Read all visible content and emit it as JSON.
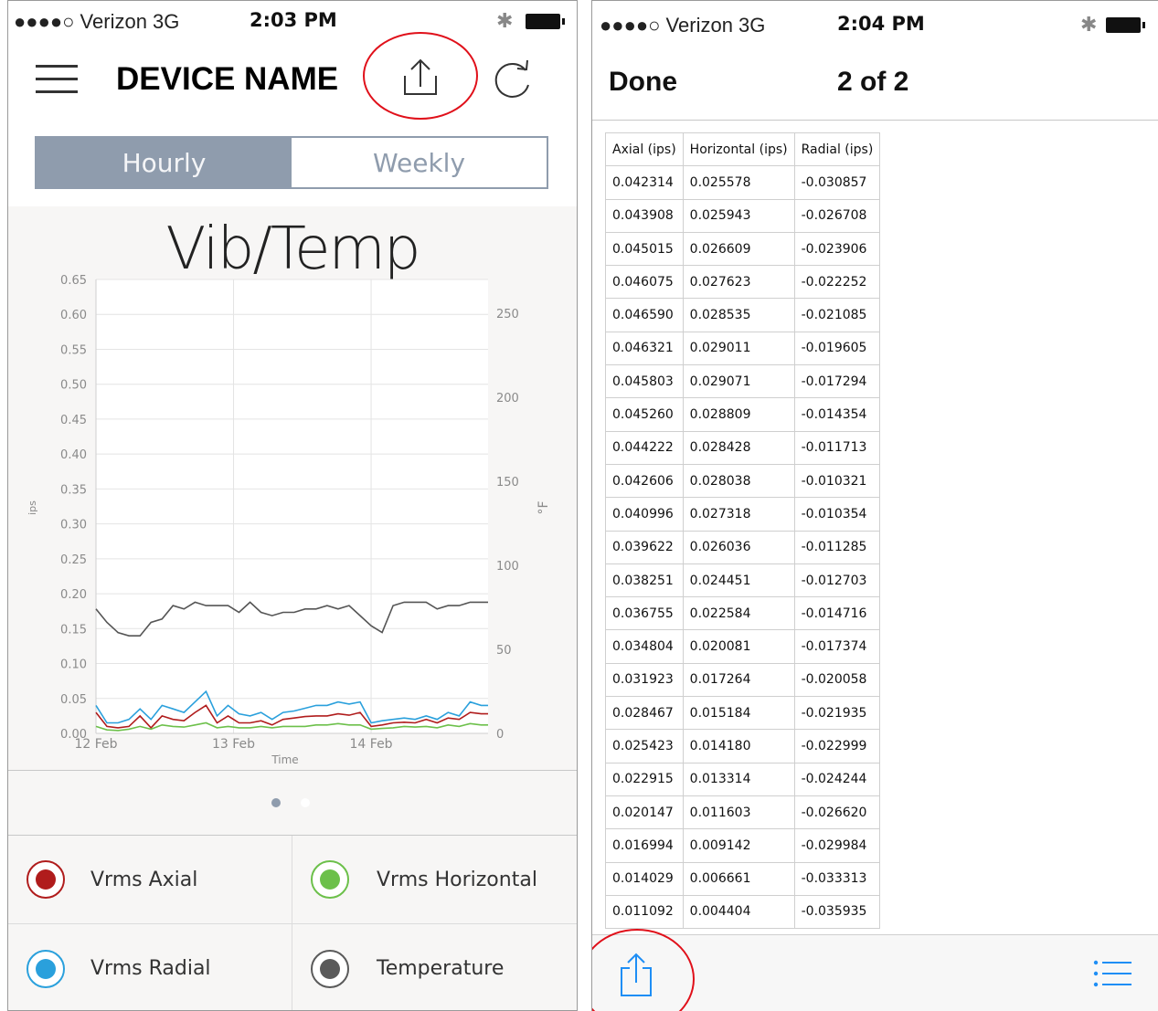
{
  "left": {
    "status": {
      "carrier": "●●●●○ Verizon  3G",
      "time": "2:03 PM",
      "bluetooth": "✱"
    },
    "header": {
      "title": "DEVICE NAME",
      "menu_icon": "hamburger-icon",
      "share_icon": "share-icon",
      "refresh_icon": "refresh-icon"
    },
    "segments": {
      "hourly": "Hourly",
      "weekly": "Weekly",
      "selected": "Hourly"
    },
    "chart_data": {
      "type": "line",
      "title": "Vib/Temp",
      "xlabel": "Time",
      "ylabel": "ips",
      "y2label": "°F",
      "x_ticks": [
        "12 Feb",
        "13 Feb",
        "14 Feb"
      ],
      "y_ticks": [
        "0.00",
        "0.05",
        "0.10",
        "0.15",
        "0.20",
        "0.25",
        "0.30",
        "0.35",
        "0.40",
        "0.45",
        "0.50",
        "0.55",
        "0.60",
        "0.65"
      ],
      "y2_ticks": [
        "0",
        "50",
        "100",
        "150",
        "200",
        "250"
      ],
      "ylim": [
        0,
        0.65
      ],
      "y2lim": [
        0,
        270
      ],
      "xlim": [
        0,
        2.85
      ],
      "grid": true,
      "series": [
        {
          "name": "Temperature",
          "axis": "right",
          "color": "#555555",
          "x": [
            0,
            0.08,
            0.16,
            0.24,
            0.32,
            0.4,
            0.48,
            0.56,
            0.64,
            0.72,
            0.8,
            0.88,
            0.96,
            1.04,
            1.12,
            1.2,
            1.28,
            1.36,
            1.44,
            1.52,
            1.6,
            1.68,
            1.76,
            1.84,
            1.92,
            2.0,
            2.08,
            2.16,
            2.24,
            2.32,
            2.4,
            2.48,
            2.56,
            2.64,
            2.72,
            2.8,
            2.85
          ],
          "values": [
            74,
            66,
            60,
            58,
            58,
            66,
            68,
            76,
            74,
            78,
            76,
            76,
            76,
            72,
            78,
            72,
            70,
            72,
            72,
            74,
            74,
            76,
            74,
            76,
            70,
            64,
            60,
            76,
            78,
            78,
            78,
            74,
            76,
            76,
            78,
            78,
            78
          ]
        },
        {
          "name": "Vrms Radial",
          "axis": "left",
          "color": "#2aa0dc",
          "x": [
            0,
            0.08,
            0.16,
            0.24,
            0.32,
            0.4,
            0.48,
            0.56,
            0.64,
            0.72,
            0.8,
            0.88,
            0.96,
            1.04,
            1.12,
            1.2,
            1.28,
            1.36,
            1.44,
            1.52,
            1.6,
            1.68,
            1.76,
            1.84,
            1.92,
            2.0,
            2.08,
            2.16,
            2.24,
            2.32,
            2.4,
            2.48,
            2.56,
            2.64,
            2.72,
            2.8,
            2.85
          ],
          "values": [
            0.04,
            0.015,
            0.015,
            0.02,
            0.035,
            0.02,
            0.04,
            0.035,
            0.03,
            0.045,
            0.06,
            0.025,
            0.04,
            0.028,
            0.025,
            0.03,
            0.02,
            0.03,
            0.032,
            0.036,
            0.04,
            0.04,
            0.045,
            0.042,
            0.045,
            0.015,
            0.018,
            0.02,
            0.022,
            0.02,
            0.025,
            0.02,
            0.03,
            0.025,
            0.045,
            0.04,
            0.04
          ]
        },
        {
          "name": "Vrms Axial",
          "axis": "left",
          "color": "#b01c1c",
          "x": [
            0,
            0.08,
            0.16,
            0.24,
            0.32,
            0.4,
            0.48,
            0.56,
            0.64,
            0.72,
            0.8,
            0.88,
            0.96,
            1.04,
            1.12,
            1.2,
            1.28,
            1.36,
            1.44,
            1.52,
            1.6,
            1.68,
            1.76,
            1.84,
            1.92,
            2.0,
            2.08,
            2.16,
            2.24,
            2.32,
            2.4,
            2.48,
            2.56,
            2.64,
            2.72,
            2.8,
            2.85
          ],
          "values": [
            0.03,
            0.01,
            0.008,
            0.01,
            0.025,
            0.008,
            0.025,
            0.02,
            0.018,
            0.03,
            0.04,
            0.015,
            0.025,
            0.015,
            0.015,
            0.018,
            0.012,
            0.02,
            0.022,
            0.024,
            0.025,
            0.025,
            0.028,
            0.026,
            0.03,
            0.01,
            0.012,
            0.015,
            0.016,
            0.015,
            0.02,
            0.015,
            0.022,
            0.02,
            0.03,
            0.028,
            0.028
          ]
        },
        {
          "name": "Vrms Horizontal",
          "axis": "left",
          "color": "#6cc04a",
          "x": [
            0,
            0.08,
            0.16,
            0.24,
            0.32,
            0.4,
            0.48,
            0.56,
            0.64,
            0.72,
            0.8,
            0.88,
            0.96,
            1.04,
            1.12,
            1.2,
            1.28,
            1.36,
            1.44,
            1.52,
            1.6,
            1.68,
            1.76,
            1.84,
            1.92,
            2.0,
            2.08,
            2.16,
            2.24,
            2.32,
            2.4,
            2.48,
            2.56,
            2.64,
            2.72,
            2.8,
            2.85
          ],
          "values": [
            0.01,
            0.005,
            0.004,
            0.006,
            0.01,
            0.006,
            0.012,
            0.01,
            0.009,
            0.012,
            0.015,
            0.008,
            0.01,
            0.008,
            0.008,
            0.01,
            0.008,
            0.01,
            0.01,
            0.01,
            0.012,
            0.012,
            0.014,
            0.012,
            0.012,
            0.006,
            0.007,
            0.008,
            0.01,
            0.009,
            0.01,
            0.008,
            0.012,
            0.01,
            0.014,
            0.012,
            0.012
          ]
        }
      ]
    },
    "legend": [
      {
        "label": "Vrms Axial",
        "color": "#b01c1c"
      },
      {
        "label": "Vrms Horizontal",
        "color": "#6cc04a"
      },
      {
        "label": "Vrms Radial",
        "color": "#2aa0dc"
      },
      {
        "label": "Temperature",
        "color": "#5a5a5a"
      }
    ]
  },
  "right": {
    "status": {
      "carrier": "●●●●○ Verizon  3G",
      "time": "2:04 PM",
      "bluetooth": "✱"
    },
    "header": {
      "done": "Done",
      "pages": "2 of 2"
    },
    "table": {
      "columns": [
        "Axial (ips)",
        "Horizontal (ips)",
        "Radial (ips)"
      ],
      "rows": [
        [
          "0.042314",
          "0.025578",
          "-0.030857"
        ],
        [
          "0.043908",
          "0.025943",
          "-0.026708"
        ],
        [
          "0.045015",
          "0.026609",
          "-0.023906"
        ],
        [
          "0.046075",
          "0.027623",
          "-0.022252"
        ],
        [
          "0.046590",
          "0.028535",
          "-0.021085"
        ],
        [
          "0.046321",
          "0.029011",
          "-0.019605"
        ],
        [
          "0.045803",
          "0.029071",
          "-0.017294"
        ],
        [
          "0.045260",
          "0.028809",
          "-0.014354"
        ],
        [
          "0.044222",
          "0.028428",
          "-0.011713"
        ],
        [
          "0.042606",
          "0.028038",
          "-0.010321"
        ],
        [
          "0.040996",
          "0.027318",
          "-0.010354"
        ],
        [
          "0.039622",
          "0.026036",
          "-0.011285"
        ],
        [
          "0.038251",
          "0.024451",
          "-0.012703"
        ],
        [
          "0.036755",
          "0.022584",
          "-0.014716"
        ],
        [
          "0.034804",
          "0.020081",
          "-0.017374"
        ],
        [
          "0.031923",
          "0.017264",
          "-0.020058"
        ],
        [
          "0.028467",
          "0.015184",
          "-0.021935"
        ],
        [
          "0.025423",
          "0.014180",
          "-0.022999"
        ],
        [
          "0.022915",
          "0.013314",
          "-0.024244"
        ],
        [
          "0.020147",
          "0.011603",
          "-0.026620"
        ],
        [
          "0.016994",
          "0.009142",
          "-0.029984"
        ],
        [
          "0.014029",
          "0.006661",
          "-0.033313"
        ],
        [
          "0.011092",
          "0.004404",
          "-0.035935"
        ]
      ]
    },
    "toolbar": {
      "share_icon": "share-icon",
      "list_icon": "list-icon"
    }
  },
  "colors": {
    "accent": "#8f9cad",
    "ios_blue": "#1e8ef5",
    "highlight": "#e0101a"
  }
}
